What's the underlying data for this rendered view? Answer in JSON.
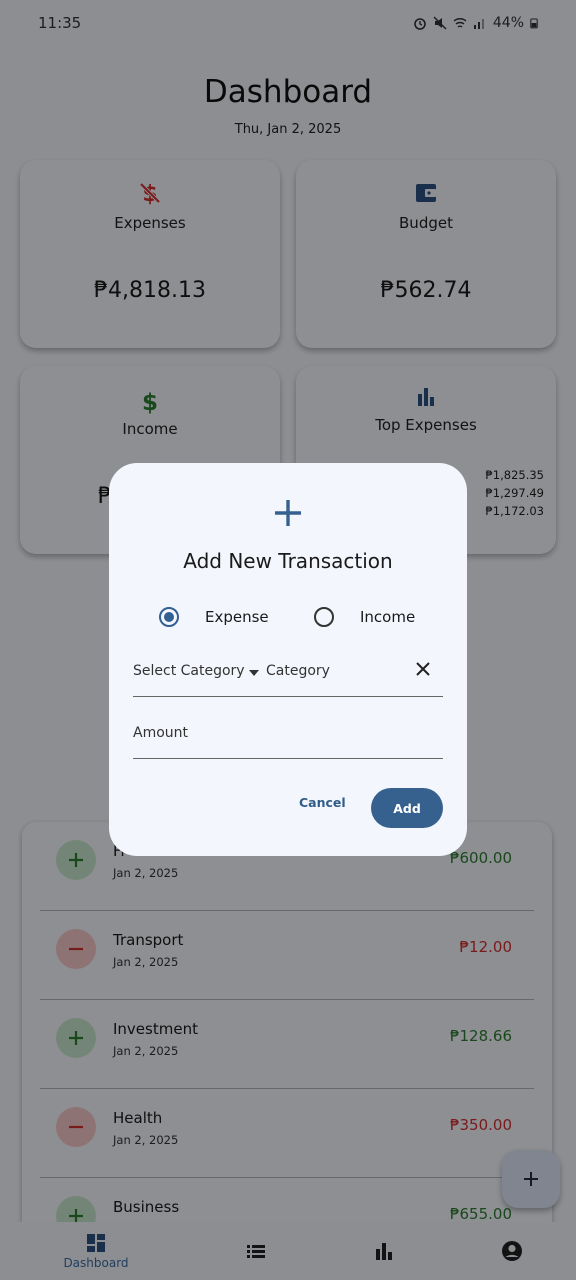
{
  "status_bar": {
    "time": "11:35",
    "battery": "44%"
  },
  "header": {
    "title": "Dashboard",
    "date": "Thu, Jan 2, 2025"
  },
  "cards": {
    "expenses": {
      "label": "Expenses",
      "value": "₱4,818.13",
      "icon": "money-off-icon",
      "color": "#d32f2f"
    },
    "budget": {
      "label": "Budget",
      "value": "₱562.74",
      "icon": "wallet-icon",
      "color": "#2c5282"
    },
    "income": {
      "label": "Income",
      "value": "₱",
      "icon": "dollar-icon",
      "color": "#2e7d32"
    },
    "top_expenses": {
      "label": "Top Expenses",
      "icon": "bar-chart-icon",
      "values": [
        "₱1,825.35",
        "₱1,297.49",
        "₱1,172.03"
      ]
    }
  },
  "transactions": [
    {
      "name": "Fr",
      "date": "Jan 2, 2025",
      "amount": "₱600.00",
      "type": "income"
    },
    {
      "name": "Transport",
      "date": "Jan 2, 2025",
      "amount": "₱12.00",
      "type": "expense"
    },
    {
      "name": "Investment",
      "date": "Jan 2, 2025",
      "amount": "₱128.66",
      "type": "income"
    },
    {
      "name": "Health",
      "date": "Jan 2, 2025",
      "amount": "₱350.00",
      "type": "expense"
    },
    {
      "name": "Business",
      "date": "",
      "amount": "₱655.00",
      "type": "income"
    }
  ],
  "bottom_nav": {
    "dashboard_label": "Dashboard",
    "active": "dashboard"
  },
  "dialog": {
    "title": "Add New Transaction",
    "radio_expense": "Expense",
    "radio_income": "Income",
    "selected_type": "expense",
    "category_select": "Select Category",
    "category_label": "Category",
    "amount_label": "Amount",
    "cancel": "Cancel",
    "add": "Add"
  },
  "colors": {
    "primary": "#36618f",
    "income": "#2e7d32",
    "expense": "#d32f2f"
  }
}
